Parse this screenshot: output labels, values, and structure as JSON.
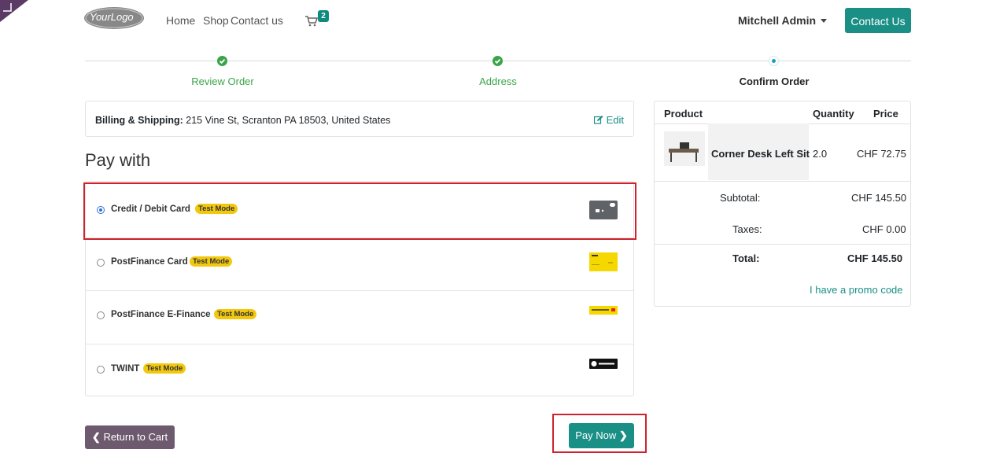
{
  "header": {
    "logo_text": "YourLogo",
    "nav": [
      "Home",
      "Shop",
      "Contact us"
    ],
    "cart_count": "2",
    "user_name": "Mitchell Admin",
    "contact_button": "Contact Us"
  },
  "progress": {
    "steps": [
      {
        "label": "Review Order",
        "state": "done"
      },
      {
        "label": "Address",
        "state": "done"
      },
      {
        "label": "Confirm Order",
        "state": "current"
      }
    ]
  },
  "billing": {
    "label": "Billing & Shipping:",
    "address": "215 Vine St, Scranton PA 18503, United States",
    "edit": "Edit"
  },
  "payment": {
    "heading": "Pay with",
    "methods": [
      {
        "name": "Credit / Debit Card",
        "badge": "Test Mode",
        "selected": true,
        "icon": "credit-card-icon"
      },
      {
        "name": "PostFinance Card",
        "badge": "Test Mode",
        "selected": false,
        "icon": "postfinance-card-icon"
      },
      {
        "name": "PostFinance E-Finance",
        "badge": "Test Mode",
        "selected": false,
        "icon": "postfinance-logo-icon"
      },
      {
        "name": "TWINT",
        "badge": "Test Mode",
        "selected": false,
        "icon": "twint-logo-icon"
      }
    ]
  },
  "summary": {
    "columns": [
      "Product",
      "Quantity",
      "Price"
    ],
    "product": {
      "name": "Corner Desk Left Sit",
      "quantity": "2.0",
      "price": "CHF 72.75"
    },
    "subtotal_label": "Subtotal:",
    "subtotal": "CHF 145.50",
    "taxes_label": "Taxes:",
    "taxes": "CHF 0.00",
    "total_label": "Total:",
    "total": "CHF 145.50",
    "promo": "I have a promo code"
  },
  "actions": {
    "return": "Return to Cart",
    "pay_now": "Pay Now"
  },
  "colors": {
    "primary": "#1a8f86",
    "success": "#3aa44a",
    "badge": "#f2c80f",
    "highlight": "#d0222e",
    "secondary": "#6e5a6e"
  }
}
